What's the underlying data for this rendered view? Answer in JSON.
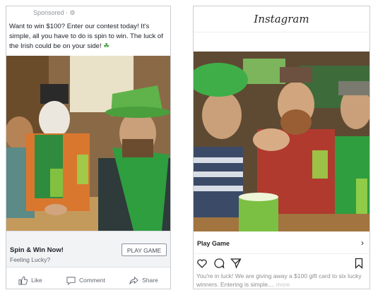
{
  "facebook": {
    "sponsored_label": "Sponsored · ⚙",
    "caption": "Want to win $100? Enter our contest today! It's simple, all you have to do is spin to win. The luck of the Irish could be on your side!",
    "caption_emoji": "☘",
    "cta_title": "Spin & Win Now!",
    "cta_subtitle": "Feeling Lucky?",
    "play_button": "PLAY GAME",
    "actions": {
      "like": "Like",
      "comment": "Comment",
      "share": "Share"
    }
  },
  "instagram": {
    "logo": "Instagram",
    "cta_label": "Play Game",
    "cta_chevron": "›",
    "caption": "You're in luck! We are giving away a $100 gift card to six lucky winners. Entering is simple.... ",
    "more_label": "more"
  },
  "colors": {
    "fb_cta_bg": "#f2f3f5",
    "leprechaun_green": "#2e9e3f",
    "beer_green": "#7bc043"
  }
}
